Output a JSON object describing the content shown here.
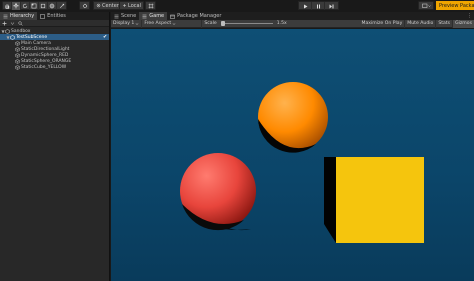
{
  "toolbar": {
    "tools": [
      "hand-tool",
      "move-tool",
      "rotate-tool",
      "scale-tool",
      "rect-tool",
      "transform-tool",
      "custom-tool"
    ],
    "center_label": "Center",
    "local_label": "Local",
    "preview_label": "Preview Packa"
  },
  "hierarchy": {
    "tabs": [
      "Hierarchy",
      "Entities"
    ],
    "items": [
      {
        "label": "Sandbox",
        "depth": 0
      },
      {
        "label": "TestSubScene",
        "depth": 1
      },
      {
        "label": "Main Camera",
        "depth": 2
      },
      {
        "label": "StaticDirectionalLight",
        "depth": 2
      },
      {
        "label": "DynamicSphere_RED",
        "depth": 2
      },
      {
        "label": "StaticSphere_ORANGE",
        "depth": 2
      },
      {
        "label": "StaticCube_YELLOW",
        "depth": 2
      }
    ]
  },
  "views": {
    "tabs": [
      "Scene",
      "Game",
      "Package Manager"
    ],
    "active": "Game"
  },
  "game_bar": {
    "display": "Display 1",
    "aspect": "Free Aspect",
    "scale_label": "Scale",
    "scale_value": "1.5x",
    "maximize": "Maximize On Play",
    "mute": "Mute Audio",
    "stats": "Stats",
    "gizmos": "Gizmos"
  },
  "colors": {
    "selection": "#2c5d87",
    "sky": "#0b4569",
    "sphere_red": "#e8453c",
    "sphere_orange": "#ff8a00",
    "cube_yellow": "#f5c50d",
    "preview_button": "#f0a500"
  }
}
